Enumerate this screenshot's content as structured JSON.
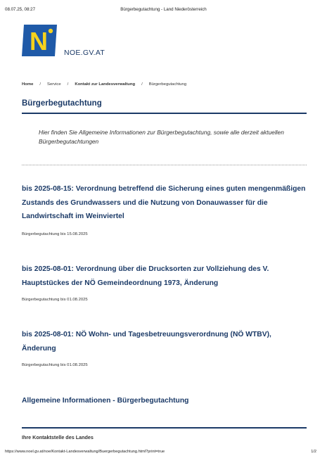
{
  "print_header": {
    "datetime": "08.07.25, 08:27",
    "doc_title": "Bürgerbegutachtung - Land Niederösterreich"
  },
  "site": {
    "logo_icon": "noe-logo-icon",
    "name": "NOE.GV.AT"
  },
  "breadcrumb": {
    "items": [
      "Home",
      "Service",
      "Kontakt zur Landesverwaltung",
      "Bürgerbegutachtung"
    ],
    "separator": "/"
  },
  "page": {
    "title": "Bürgerbegutachtung",
    "intro": "Hier finden Sie Allgemeine Informationen zur Bürgerbegutachtung, sowie alle derzeit aktuellen Bürgerbegutachtungen"
  },
  "entries": [
    {
      "title": "bis 2025-08-15: Verordnung betreffend die Sicherung eines guten mengenmäßigen Zustands des Grundwassers und die Nutzung von Donauwasser für die Landwirtschaft im Weinviertel",
      "subtitle": "Bürgerbegutachtung bis 15.08.2025"
    },
    {
      "title": "bis 2025-08-01: Verordnung über die Drucksorten zur Vollziehung des V. Hauptstückes der NÖ Gemeindeordnung 1973, Änderung",
      "subtitle": "Bürgerbegutachtung bis 01.08.2025"
    },
    {
      "title": "bis 2025-08-01: NÖ Wohn- und Tagesbetreuungsverordnung (NÖ WTBV), Änderung",
      "subtitle": "Bürgerbegutachtung bis 01.08.2025"
    }
  ],
  "general_info_link": "Allgemeine Informationen - Bürgerbegutachtung",
  "contact_heading": "Ihre Kontaktstelle des Landes",
  "print_footer": {
    "url": "https://www.noel.gv.at/noe/Kontakt-Landesverwaltung/Buergerbegutachtung.html?print=true",
    "page": "1/2"
  },
  "colors": {
    "brand_blue": "#1b3a67",
    "logo_blue": "#1f5aa8",
    "logo_yellow": "#f6d21c"
  }
}
